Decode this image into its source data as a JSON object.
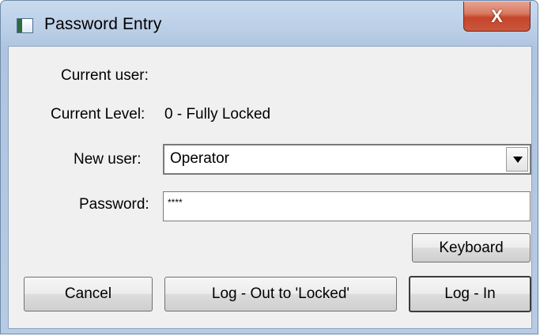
{
  "window": {
    "title": "Password Entry",
    "close_glyph": "X",
    "icon": "app-window-icon"
  },
  "form": {
    "current_user_label": "Current user:",
    "current_user_value": "",
    "current_level_label": "Current Level:",
    "current_level_value": "0 - Fully Locked",
    "new_user_label": "New user:",
    "new_user_value": "Operator",
    "password_label": "Password:",
    "password_value": "****"
  },
  "buttons": {
    "keyboard": "Keyboard",
    "cancel": "Cancel",
    "logout": "Log - Out to 'Locked'",
    "login": "Log - In"
  },
  "colors": {
    "frame": "#b9cde6",
    "close": "#c6452a",
    "client": "#f0f0f0"
  }
}
